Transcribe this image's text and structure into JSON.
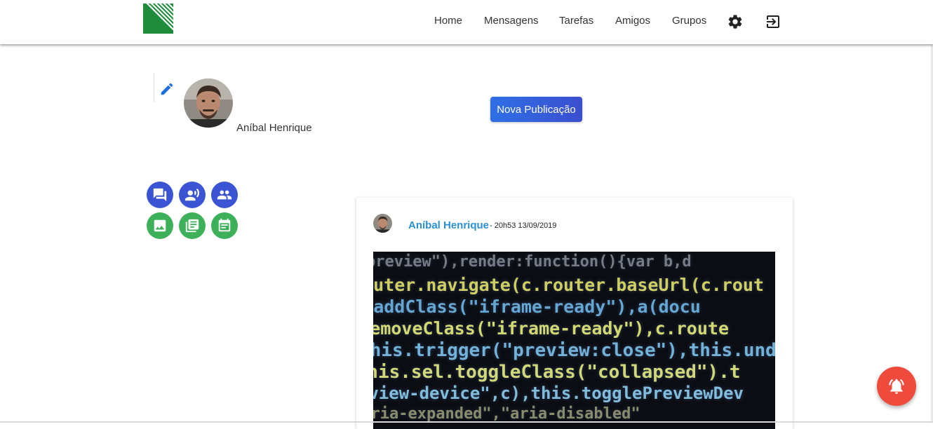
{
  "nav": {
    "links": [
      "Home",
      "Mensagens",
      "Tarefas",
      "Amigos",
      "Grupos"
    ],
    "icons": [
      "settings-icon",
      "logout-icon"
    ],
    "brand_color": "#1e8c3a"
  },
  "profile": {
    "name": "Aníbal Henrique",
    "new_post_label": "Nova Publicação"
  },
  "actions": {
    "row1": [
      "forum-icon",
      "voice-chat-icon",
      "group-icon"
    ],
    "row2": [
      "image-icon",
      "article-icon",
      "event-note-icon"
    ],
    "colors": {
      "blue": "#3a54d4",
      "green": "#3db05a"
    }
  },
  "post": {
    "author": "Aníbal Henrique",
    "meta": "- 20h53 13/09/2019",
    "image_code_lines": [
      "preview\"),render:function(){var b,d",
      "router.navigate(c.router.baseUrl(c.rout",
      "sel.addClass(\"iframe-ready\"),a(docu",
      "()),removeClass(\"iframe-ready\"),c.route",
      "this.trigger(\"preview:close\"),this.undelega",
      ",this.sel.toggleClass(\"collapsed\").t",
      "preview-device\",c),this.togglePreviewDev",
      "\"aria-expanded\",\"aria-disabled\""
    ]
  },
  "notification": {
    "icon": "bell-ring-icon",
    "color": "#ef4b3c"
  }
}
